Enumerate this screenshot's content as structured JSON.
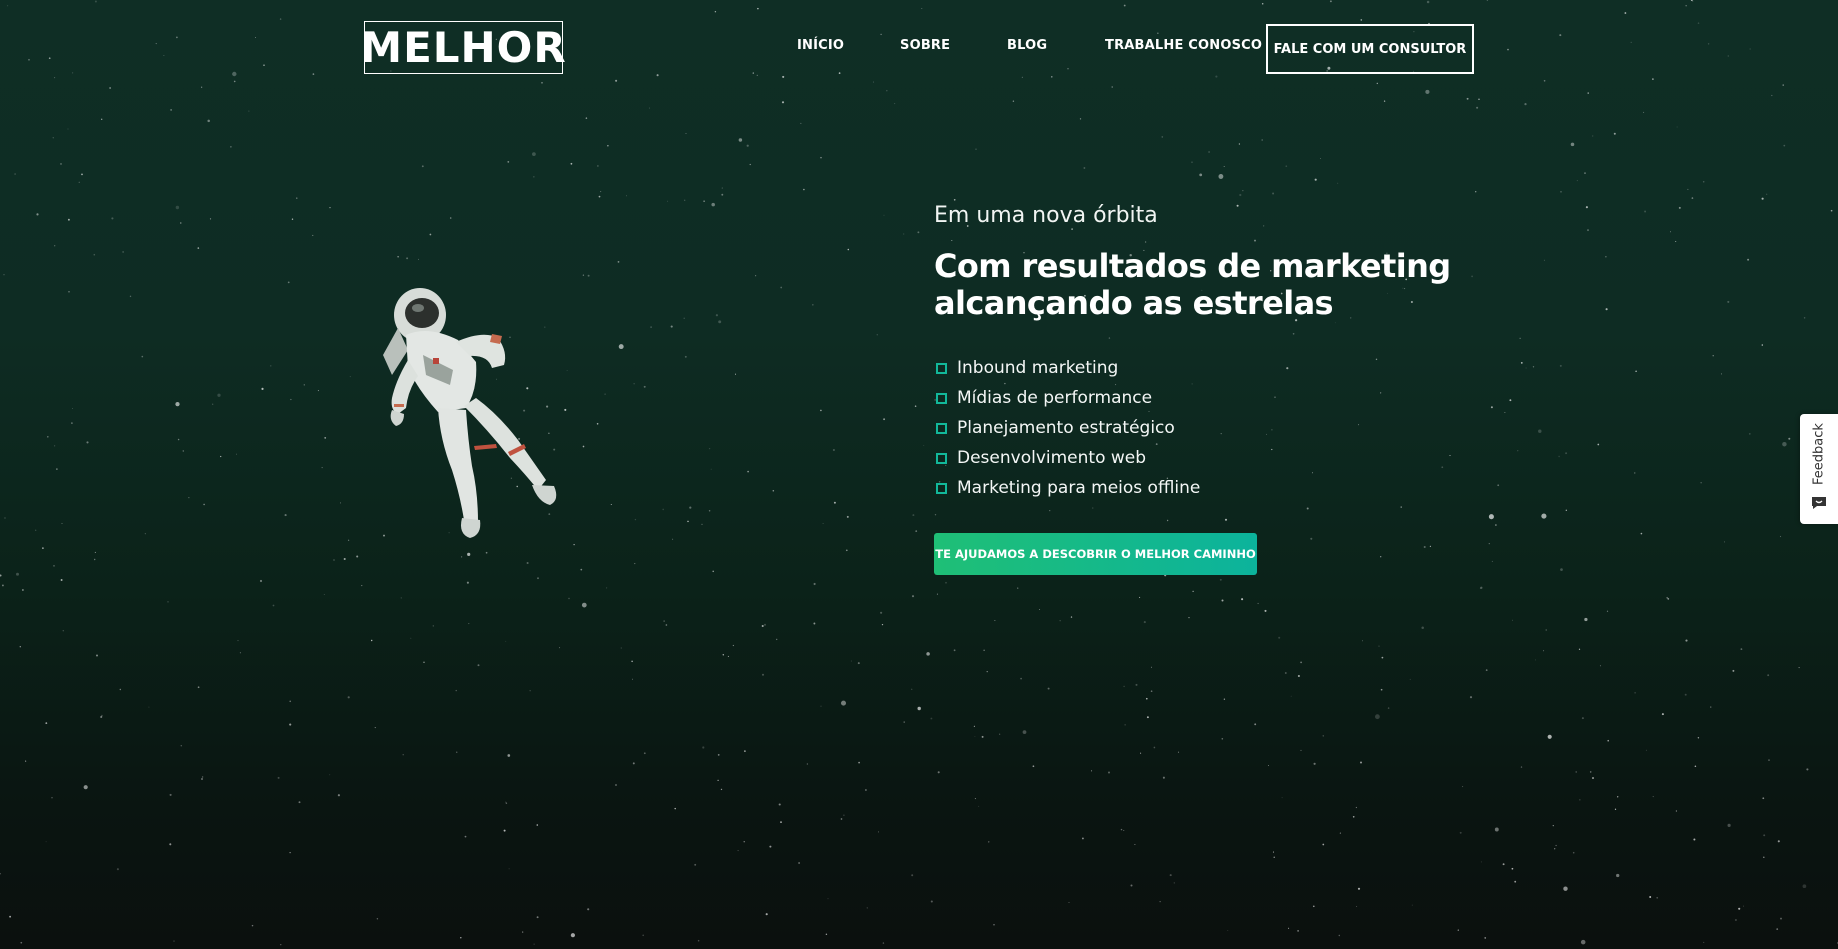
{
  "header": {
    "logo_text": "MELHOR",
    "nav": [
      {
        "label": "INÍCIO"
      },
      {
        "label": "SOBRE"
      },
      {
        "label": "BLOG"
      },
      {
        "label": "TRABALHE CONOSCO"
      }
    ],
    "cta_label": "FALE COM UM CONSULTOR"
  },
  "hero": {
    "eyebrow": "Em uma nova órbita",
    "headline_line1": "Com resultados de marketing",
    "headline_line2": "alcançando as estrelas",
    "services": [
      "Inbound marketing",
      "Mídias de performance",
      "Planejamento estratégico",
      "Desenvolvimento web",
      "Marketing para meios offline"
    ],
    "cta_label": "TE AJUDAMOS A DESCOBRIR O MELHOR CAMINHO"
  },
  "feedback": {
    "label": "Feedback",
    "icon": "chat-icon"
  },
  "colors": {
    "accent": "#12b89a",
    "button_gradient_start": "#1fbf76",
    "button_gradient_end": "#0cb39c",
    "background_top": "#0f2e25",
    "background_bottom": "#0b100e"
  }
}
